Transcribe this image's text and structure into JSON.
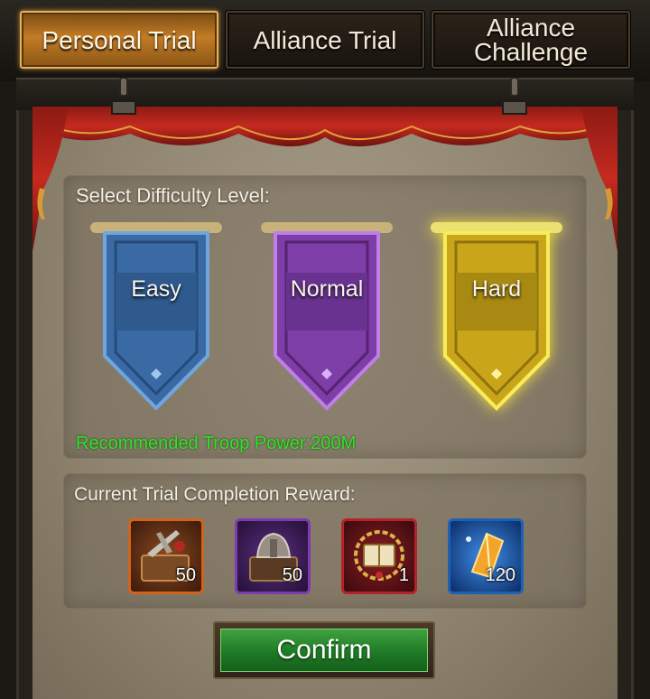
{
  "tabs": [
    {
      "label_line1": "Personal Trial",
      "label_line2": "",
      "active": true
    },
    {
      "label_line1": "Alliance Trial",
      "label_line2": "",
      "active": false
    },
    {
      "label_line1": "Alliance",
      "label_line2": "Challenge",
      "active": false
    }
  ],
  "difficulty": {
    "title": "Select Difficulty Level:",
    "levels": [
      {
        "label": "Easy",
        "color": "#3a6da6",
        "selected": false
      },
      {
        "label": "Normal",
        "color": "#8a43b3",
        "selected": false
      },
      {
        "label": "Hard",
        "color": "#d4b21c",
        "selected": true
      }
    ],
    "recommended": "Recommended Troop Power:200M"
  },
  "rewards": {
    "title": "Current Trial Completion Reward:",
    "items": [
      {
        "icon": "weapon-chest-icon",
        "count": "50",
        "frame_color": "#d0641c"
      },
      {
        "icon": "armor-chest-icon",
        "count": "50",
        "frame_color": "#7a3cb0"
      },
      {
        "icon": "laurel-book-icon",
        "count": "1",
        "frame_color": "#b3232a"
      },
      {
        "icon": "crystal-shard-icon",
        "count": "120",
        "frame_color": "#1d61b5"
      }
    ]
  },
  "confirm_label": "Confirm"
}
